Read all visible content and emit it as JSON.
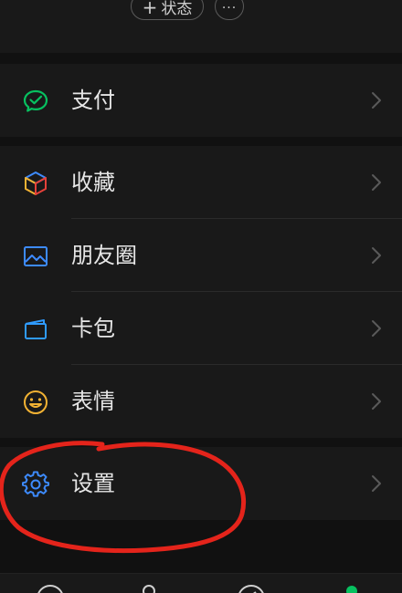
{
  "profile": {
    "status_plus": "+",
    "status_label": "状态",
    "more_label": "···"
  },
  "menu": {
    "pay": {
      "label": "支付",
      "icon": "wechat-pay-icon",
      "color": "#07C160"
    },
    "favorites": {
      "label": "收藏",
      "icon": "cube-icon"
    },
    "moments": {
      "label": "朋友圈",
      "icon": "image-icon",
      "color": "#3D8BFF"
    },
    "cards": {
      "label": "卡包",
      "icon": "wallet-card-icon",
      "color": "#2F9BFF"
    },
    "stickers": {
      "label": "表情",
      "icon": "smiley-icon",
      "color": "#F2B233"
    },
    "settings": {
      "label": "设置",
      "icon": "gear-icon",
      "color": "#3D8BFF"
    }
  },
  "colors": {
    "background": "#111111",
    "surface": "#191919",
    "text": "#E6E6E6",
    "annotation": "#E4241B",
    "accent_green": "#07C160"
  }
}
